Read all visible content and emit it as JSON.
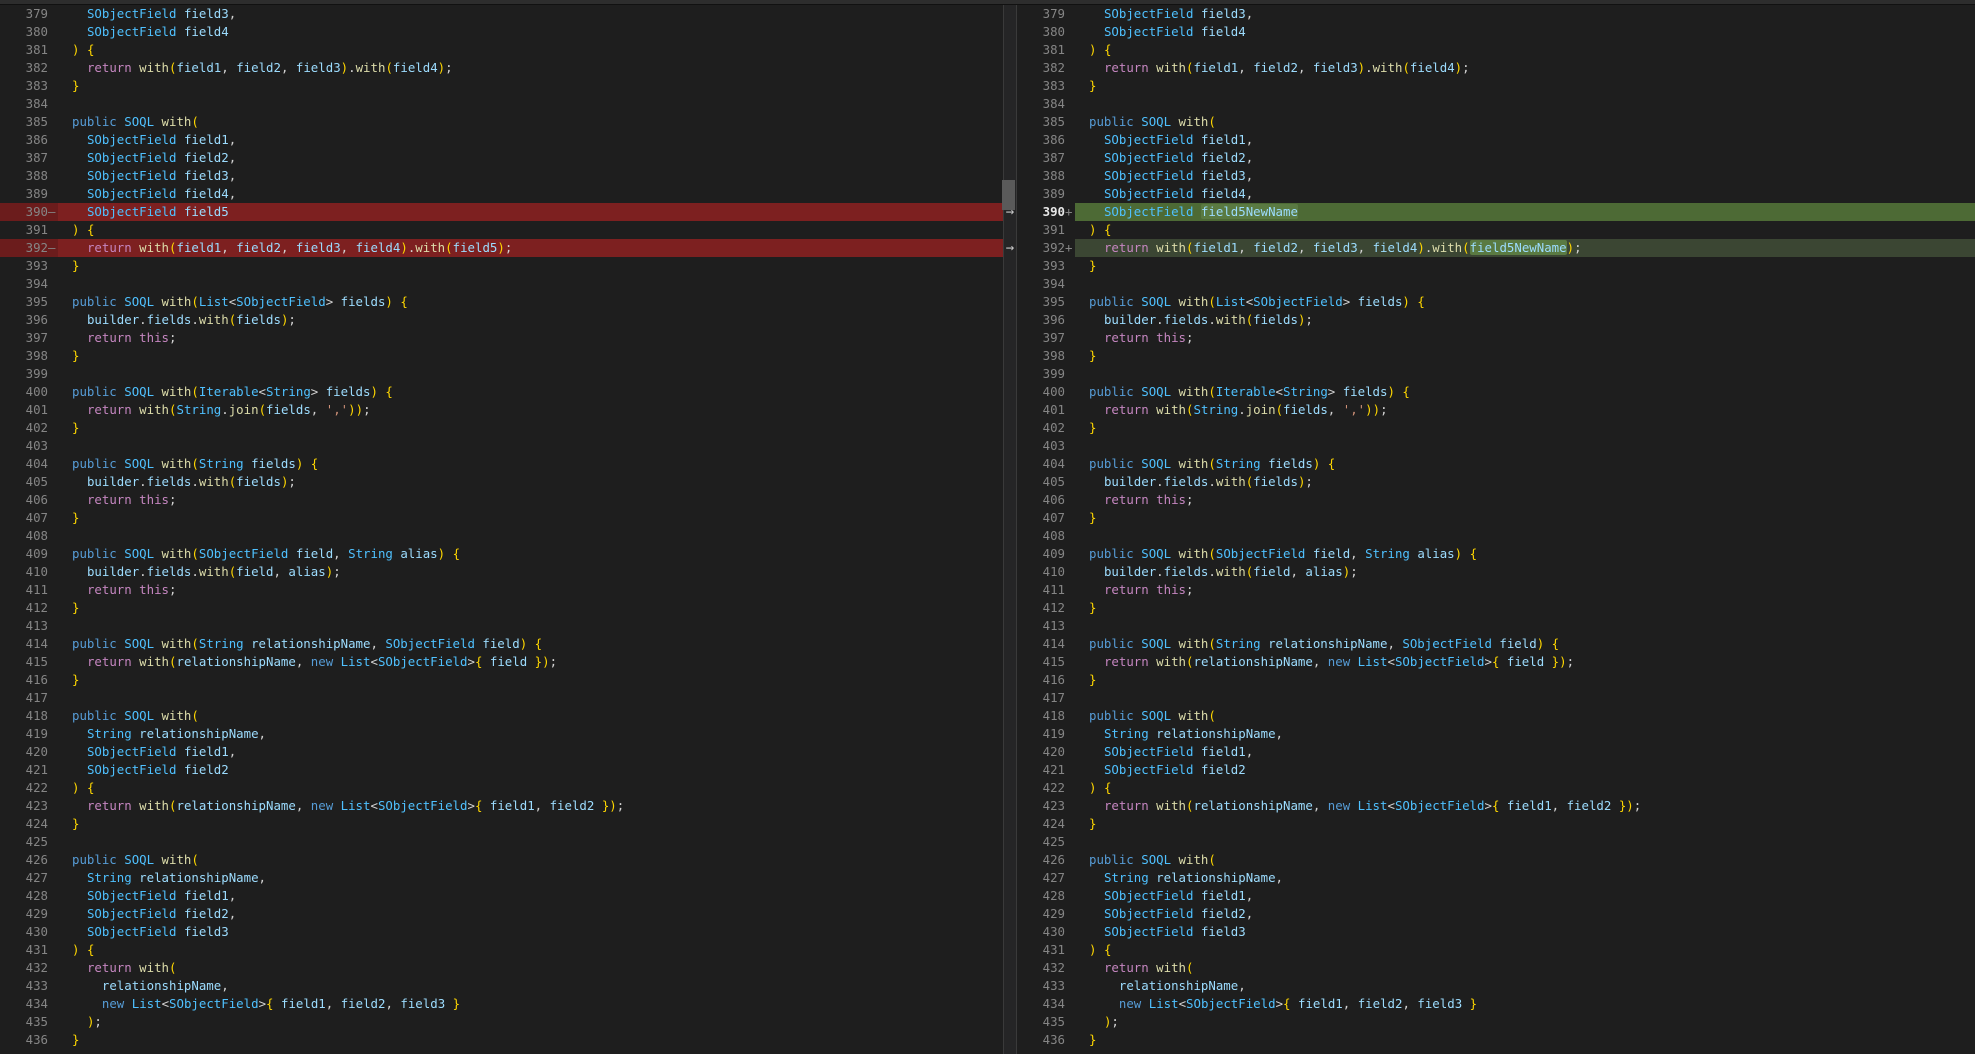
{
  "left_lines": [
    {
      "n": "379",
      "m": "",
      "c": "  SObjectField field3,",
      "t": ""
    },
    {
      "n": "380",
      "m": "",
      "c": "  SObjectField field4",
      "t": ""
    },
    {
      "n": "381",
      "m": "",
      "c": ") {",
      "t": ""
    },
    {
      "n": "382",
      "m": "",
      "c": "  return with(field1, field2, field3).with(field4);",
      "t": ""
    },
    {
      "n": "383",
      "m": "",
      "c": "}",
      "t": ""
    },
    {
      "n": "384",
      "m": "",
      "c": "",
      "t": ""
    },
    {
      "n": "385",
      "m": "",
      "c": "public SOQL with(",
      "t": ""
    },
    {
      "n": "386",
      "m": "",
      "c": "  SObjectField field1,",
      "t": ""
    },
    {
      "n": "387",
      "m": "",
      "c": "  SObjectField field2,",
      "t": ""
    },
    {
      "n": "388",
      "m": "",
      "c": "  SObjectField field3,",
      "t": ""
    },
    {
      "n": "389",
      "m": "",
      "c": "  SObjectField field4,",
      "t": ""
    },
    {
      "n": "390",
      "m": "—",
      "c": "  SObjectField field5",
      "t": "del"
    },
    {
      "n": "391",
      "m": "",
      "c": ") {",
      "t": ""
    },
    {
      "n": "392",
      "m": "—",
      "c": "  return with(field1, field2, field3, field4).with(field5);",
      "t": "del"
    },
    {
      "n": "393",
      "m": "",
      "c": "}",
      "t": ""
    },
    {
      "n": "394",
      "m": "",
      "c": "",
      "t": ""
    },
    {
      "n": "395",
      "m": "",
      "c": "public SOQL with(List<SObjectField> fields) {",
      "t": ""
    },
    {
      "n": "396",
      "m": "",
      "c": "  builder.fields.with(fields);",
      "t": ""
    },
    {
      "n": "397",
      "m": "",
      "c": "  return this;",
      "t": ""
    },
    {
      "n": "398",
      "m": "",
      "c": "}",
      "t": ""
    },
    {
      "n": "399",
      "m": "",
      "c": "",
      "t": ""
    },
    {
      "n": "400",
      "m": "",
      "c": "public SOQL with(Iterable<String> fields) {",
      "t": ""
    },
    {
      "n": "401",
      "m": "",
      "c": "  return with(String.join(fields, ','));",
      "t": ""
    },
    {
      "n": "402",
      "m": "",
      "c": "}",
      "t": ""
    },
    {
      "n": "403",
      "m": "",
      "c": "",
      "t": ""
    },
    {
      "n": "404",
      "m": "",
      "c": "public SOQL with(String fields) {",
      "t": ""
    },
    {
      "n": "405",
      "m": "",
      "c": "  builder.fields.with(fields);",
      "t": ""
    },
    {
      "n": "406",
      "m": "",
      "c": "  return this;",
      "t": ""
    },
    {
      "n": "407",
      "m": "",
      "c": "}",
      "t": ""
    },
    {
      "n": "408",
      "m": "",
      "c": "",
      "t": ""
    },
    {
      "n": "409",
      "m": "",
      "c": "public SOQL with(SObjectField field, String alias) {",
      "t": ""
    },
    {
      "n": "410",
      "m": "",
      "c": "  builder.fields.with(field, alias);",
      "t": ""
    },
    {
      "n": "411",
      "m": "",
      "c": "  return this;",
      "t": ""
    },
    {
      "n": "412",
      "m": "",
      "c": "}",
      "t": ""
    },
    {
      "n": "413",
      "m": "",
      "c": "",
      "t": ""
    },
    {
      "n": "414",
      "m": "",
      "c": "public SOQL with(String relationshipName, SObjectField field) {",
      "t": ""
    },
    {
      "n": "415",
      "m": "",
      "c": "  return with(relationshipName, new List<SObjectField>{ field });",
      "t": ""
    },
    {
      "n": "416",
      "m": "",
      "c": "}",
      "t": ""
    },
    {
      "n": "417",
      "m": "",
      "c": "",
      "t": ""
    },
    {
      "n": "418",
      "m": "",
      "c": "public SOQL with(",
      "t": ""
    },
    {
      "n": "419",
      "m": "",
      "c": "  String relationshipName,",
      "t": ""
    },
    {
      "n": "420",
      "m": "",
      "c": "  SObjectField field1,",
      "t": ""
    },
    {
      "n": "421",
      "m": "",
      "c": "  SObjectField field2",
      "t": ""
    },
    {
      "n": "422",
      "m": "",
      "c": ") {",
      "t": ""
    },
    {
      "n": "423",
      "m": "",
      "c": "  return with(relationshipName, new List<SObjectField>{ field1, field2 });",
      "t": ""
    },
    {
      "n": "424",
      "m": "",
      "c": "}",
      "t": ""
    },
    {
      "n": "425",
      "m": "",
      "c": "",
      "t": ""
    },
    {
      "n": "426",
      "m": "",
      "c": "public SOQL with(",
      "t": ""
    },
    {
      "n": "427",
      "m": "",
      "c": "  String relationshipName,",
      "t": ""
    },
    {
      "n": "428",
      "m": "",
      "c": "  SObjectField field1,",
      "t": ""
    },
    {
      "n": "429",
      "m": "",
      "c": "  SObjectField field2,",
      "t": ""
    },
    {
      "n": "430",
      "m": "",
      "c": "  SObjectField field3",
      "t": ""
    },
    {
      "n": "431",
      "m": "",
      "c": ") {",
      "t": ""
    },
    {
      "n": "432",
      "m": "",
      "c": "  return with(",
      "t": ""
    },
    {
      "n": "433",
      "m": "",
      "c": "    relationshipName,",
      "t": ""
    },
    {
      "n": "434",
      "m": "",
      "c": "    new List<SObjectField>{ field1, field2, field3 }",
      "t": ""
    },
    {
      "n": "435",
      "m": "",
      "c": "  );",
      "t": ""
    },
    {
      "n": "436",
      "m": "",
      "c": "}",
      "t": ""
    }
  ],
  "right_lines": [
    {
      "n": "379",
      "m": "",
      "c": "  SObjectField field3,",
      "t": ""
    },
    {
      "n": "380",
      "m": "",
      "c": "  SObjectField field4",
      "t": ""
    },
    {
      "n": "381",
      "m": "",
      "c": ") {",
      "t": ""
    },
    {
      "n": "382",
      "m": "",
      "c": "  return with(field1, field2, field3).with(field4);",
      "t": ""
    },
    {
      "n": "383",
      "m": "",
      "c": "}",
      "t": ""
    },
    {
      "n": "384",
      "m": "",
      "c": "",
      "t": ""
    },
    {
      "n": "385",
      "m": "",
      "c": "public SOQL with(",
      "t": ""
    },
    {
      "n": "386",
      "m": "",
      "c": "  SObjectField field1,",
      "t": ""
    },
    {
      "n": "387",
      "m": "",
      "c": "  SObjectField field2,",
      "t": ""
    },
    {
      "n": "388",
      "m": "",
      "c": "  SObjectField field3,",
      "t": ""
    },
    {
      "n": "389",
      "m": "",
      "c": "  SObjectField field4,",
      "t": ""
    },
    {
      "n": "390",
      "m": "+",
      "c": "  SObjectField field5NewName",
      "t": "add-strong",
      "cur": true
    },
    {
      "n": "391",
      "m": "",
      "c": ") {",
      "t": ""
    },
    {
      "n": "392",
      "m": "+",
      "c": "  return with(field1, field2, field3, field4).with(field5NewName);",
      "t": "add-soft"
    },
    {
      "n": "393",
      "m": "",
      "c": "}",
      "t": ""
    },
    {
      "n": "394",
      "m": "",
      "c": "",
      "t": ""
    },
    {
      "n": "395",
      "m": "",
      "c": "public SOQL with(List<SObjectField> fields) {",
      "t": ""
    },
    {
      "n": "396",
      "m": "",
      "c": "  builder.fields.with(fields);",
      "t": ""
    },
    {
      "n": "397",
      "m": "",
      "c": "  return this;",
      "t": ""
    },
    {
      "n": "398",
      "m": "",
      "c": "}",
      "t": ""
    },
    {
      "n": "399",
      "m": "",
      "c": "",
      "t": ""
    },
    {
      "n": "400",
      "m": "",
      "c": "public SOQL with(Iterable<String> fields) {",
      "t": ""
    },
    {
      "n": "401",
      "m": "",
      "c": "  return with(String.join(fields, ','));",
      "t": ""
    },
    {
      "n": "402",
      "m": "",
      "c": "}",
      "t": ""
    },
    {
      "n": "403",
      "m": "",
      "c": "",
      "t": ""
    },
    {
      "n": "404",
      "m": "",
      "c": "public SOQL with(String fields) {",
      "t": ""
    },
    {
      "n": "405",
      "m": "",
      "c": "  builder.fields.with(fields);",
      "t": ""
    },
    {
      "n": "406",
      "m": "",
      "c": "  return this;",
      "t": ""
    },
    {
      "n": "407",
      "m": "",
      "c": "}",
      "t": ""
    },
    {
      "n": "408",
      "m": "",
      "c": "",
      "t": ""
    },
    {
      "n": "409",
      "m": "",
      "c": "public SOQL with(SObjectField field, String alias) {",
      "t": ""
    },
    {
      "n": "410",
      "m": "",
      "c": "  builder.fields.with(field, alias);",
      "t": ""
    },
    {
      "n": "411",
      "m": "",
      "c": "  return this;",
      "t": ""
    },
    {
      "n": "412",
      "m": "",
      "c": "}",
      "t": ""
    },
    {
      "n": "413",
      "m": "",
      "c": "",
      "t": ""
    },
    {
      "n": "414",
      "m": "",
      "c": "public SOQL with(String relationshipName, SObjectField field) {",
      "t": ""
    },
    {
      "n": "415",
      "m": "",
      "c": "  return with(relationshipName, new List<SObjectField>{ field });",
      "t": ""
    },
    {
      "n": "416",
      "m": "",
      "c": "}",
      "t": ""
    },
    {
      "n": "417",
      "m": "",
      "c": "",
      "t": ""
    },
    {
      "n": "418",
      "m": "",
      "c": "public SOQL with(",
      "t": ""
    },
    {
      "n": "419",
      "m": "",
      "c": "  String relationshipName,",
      "t": ""
    },
    {
      "n": "420",
      "m": "",
      "c": "  SObjectField field1,",
      "t": ""
    },
    {
      "n": "421",
      "m": "",
      "c": "  SObjectField field2",
      "t": ""
    },
    {
      "n": "422",
      "m": "",
      "c": ") {",
      "t": ""
    },
    {
      "n": "423",
      "m": "",
      "c": "  return with(relationshipName, new List<SObjectField>{ field1, field2 });",
      "t": ""
    },
    {
      "n": "424",
      "m": "",
      "c": "}",
      "t": ""
    },
    {
      "n": "425",
      "m": "",
      "c": "",
      "t": ""
    },
    {
      "n": "426",
      "m": "",
      "c": "public SOQL with(",
      "t": ""
    },
    {
      "n": "427",
      "m": "",
      "c": "  String relationshipName,",
      "t": ""
    },
    {
      "n": "428",
      "m": "",
      "c": "  SObjectField field1,",
      "t": ""
    },
    {
      "n": "429",
      "m": "",
      "c": "  SObjectField field2,",
      "t": ""
    },
    {
      "n": "430",
      "m": "",
      "c": "  SObjectField field3",
      "t": ""
    },
    {
      "n": "431",
      "m": "",
      "c": ") {",
      "t": ""
    },
    {
      "n": "432",
      "m": "",
      "c": "  return with(",
      "t": ""
    },
    {
      "n": "433",
      "m": "",
      "c": "    relationshipName,",
      "t": ""
    },
    {
      "n": "434",
      "m": "",
      "c": "    new List<SObjectField>{ field1, field2, field3 }",
      "t": ""
    },
    {
      "n": "435",
      "m": "",
      "c": "  );",
      "t": ""
    },
    {
      "n": "436",
      "m": "",
      "c": "}",
      "t": ""
    }
  ],
  "highlight_word": "field5NewName",
  "change_arrow_icon": "arrow-right-icon",
  "arrow_glyph": "→",
  "colors": {
    "background": "#1e1e1e",
    "deleted_line": "#7d2020",
    "added_line": "#4d6a35",
    "added_line_soft": "#3b4633",
    "keyword": "#569cd6",
    "type": "#4fc1ff",
    "function": "#dcdcaa",
    "return_keyword": "#c586c0",
    "string": "#ce9178",
    "line_number": "#858585"
  }
}
